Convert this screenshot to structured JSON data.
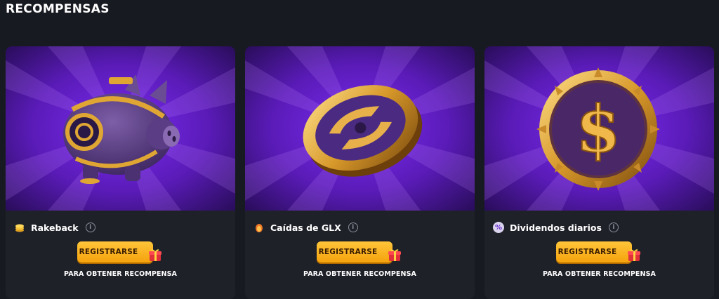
{
  "section": {
    "title": "RECOMPENSAS"
  },
  "colors": {
    "background": "#181a22",
    "card": "#1f2129",
    "art_purple": "#7a2cf0",
    "button": "#ffb21f",
    "gold": "#e0a634"
  },
  "cards": [
    {
      "name": "Rakeback",
      "badge_icon": "coins-icon",
      "art": "piggy-bank-art",
      "info_icon": "info-icon",
      "button_label": "REGISTRARSE",
      "caption": "PARA OBTENER RECOMPENSA"
    },
    {
      "name": "Caídas de GLX",
      "badge_icon": "flame-egg-icon",
      "art": "glx-coin-art",
      "info_icon": "info-icon",
      "button_label": "REGISTRARSE",
      "caption": "PARA OBTENER RECOMPENSA"
    },
    {
      "name": "Dividendos diarios",
      "badge_icon": "percent-icon",
      "art": "dollar-coin-art",
      "info_icon": "info-icon",
      "button_label": "REGISTRARSE",
      "caption": "PARA OBTENER RECOMPENSA"
    }
  ]
}
